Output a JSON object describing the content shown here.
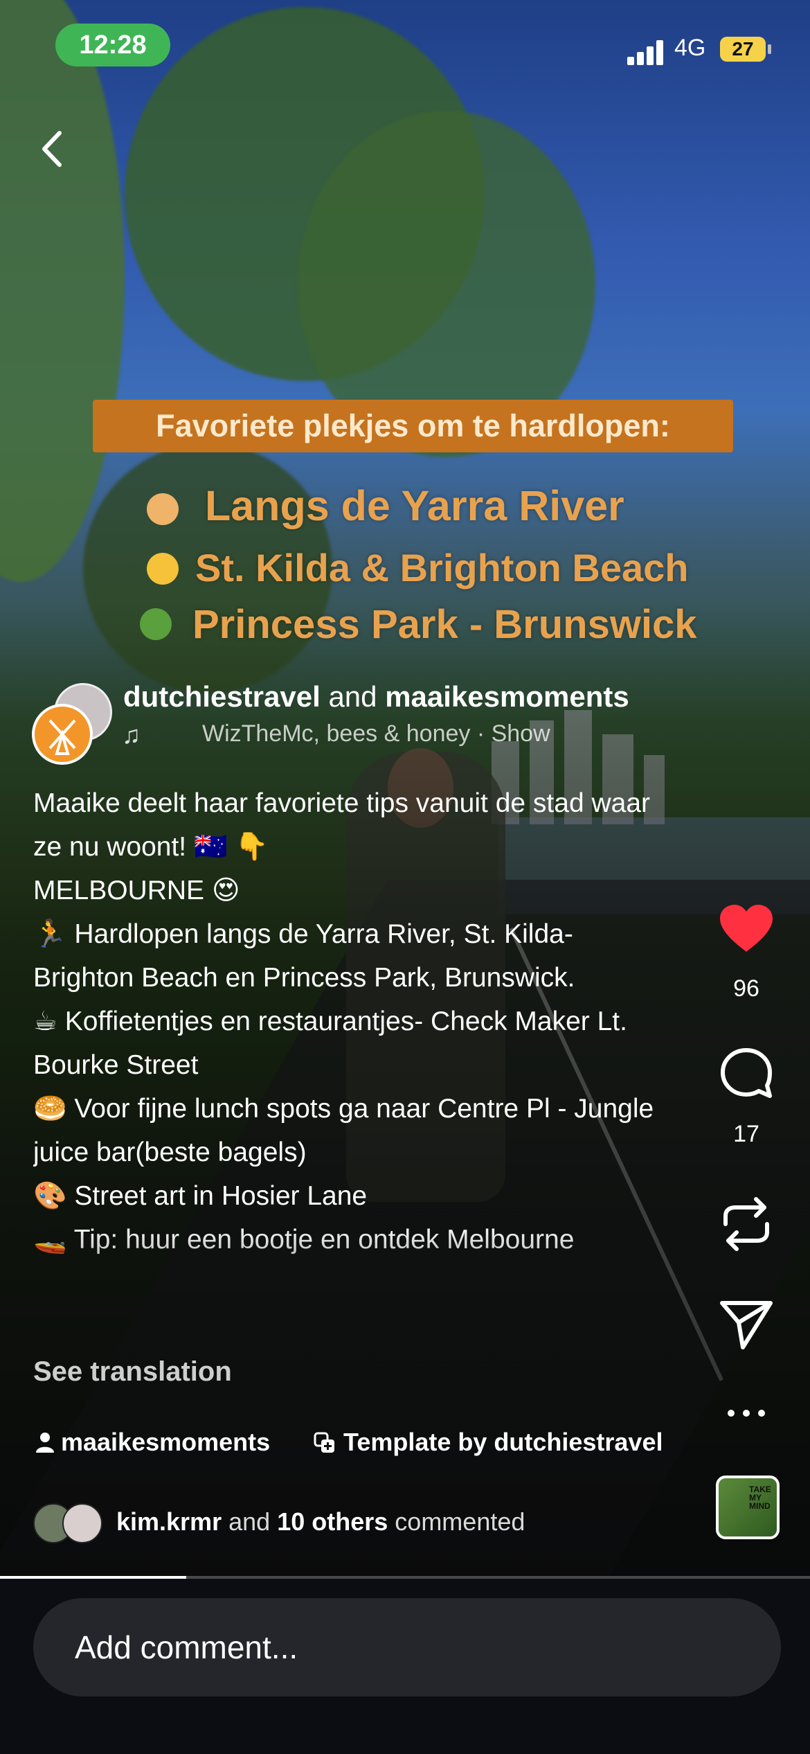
{
  "status_bar": {
    "time": "12:28",
    "network": "4G",
    "battery": "27"
  },
  "video_overlay": {
    "title": "Favoriete plekjes om te hardlopen:",
    "spots": [
      "Langs de Yarra River",
      "St. Kilda & Brighton Beach",
      "Princess Park - Brunswick"
    ]
  },
  "post": {
    "author_1": "dutchiestravel",
    "joiner": "and",
    "author_2": "maaikesmoments",
    "music": "WizTheMc, bees & honey · Show",
    "caption": [
      "Maaike deelt haar favoriete tips vanuit de stad waar ze nu woont! 🇦🇺 👇",
      "",
      "MELBOURNE 😍",
      "",
      "🏃 Hardlopen langs de Yarra River, St. Kilda-Brighton Beach en Princess Park, Brunswick.",
      "☕ Koffietentjes en restaurantjes- Check Maker Lt. Bourke Street",
      "🥯 Voor fijne lunch spots ga naar Centre Pl - Jungle juice bar(beste bagels)",
      "🎨 Street art in Hosier Lane",
      "🚤 Tip: huur een bootje en ontdek Melbourne"
    ],
    "see_translation": "See translation",
    "tagged_user": "maaikesmoments",
    "template_label": "Template by dutchiestravel",
    "comment_summary": {
      "user": "kim.krmr",
      "middle": "and",
      "others": "10 others",
      "suffix": "commented"
    }
  },
  "actions": {
    "likes": "96",
    "comments": "17"
  },
  "album_art_text": "TAKE MY MIND",
  "progress_fraction": 0.23,
  "comment_box": {
    "placeholder": "Add comment..."
  },
  "colors": {
    "like": "#ff3040",
    "status_time_bg": "#3fb556",
    "battery": "#f6d24a",
    "overlay_title_bg": "#c5731f",
    "overlay_text": "#e8a24e"
  }
}
